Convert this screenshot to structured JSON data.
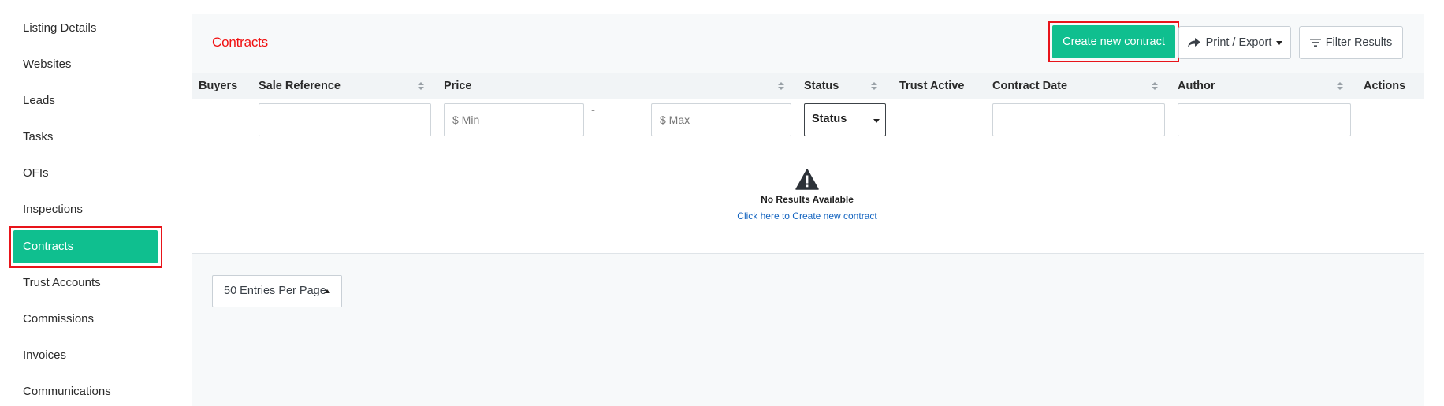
{
  "sidebar": {
    "items": [
      {
        "label": "Listing Details"
      },
      {
        "label": "Websites"
      },
      {
        "label": "Leads"
      },
      {
        "label": "Tasks"
      },
      {
        "label": "OFIs"
      },
      {
        "label": "Inspections"
      },
      {
        "label": "Contracts",
        "active": true
      },
      {
        "label": "Trust Accounts"
      },
      {
        "label": "Commissions"
      },
      {
        "label": "Invoices"
      },
      {
        "label": "Communications"
      }
    ]
  },
  "header": {
    "title": "Contracts",
    "create_label": "Create new contract",
    "print_label": "Print / Export",
    "filter_label": "Filter Results"
  },
  "table": {
    "columns": [
      "Buyers",
      "Sale Reference",
      "Price",
      "Status",
      "Trust Active",
      "Contract Date",
      "Author",
      "Actions"
    ],
    "filters": {
      "price_min_placeholder": "$ Min",
      "price_separator": "-",
      "price_max_placeholder": "$ Max",
      "status_selected": "Status"
    },
    "empty": {
      "message": "No Results Available",
      "link": "Click here to Create new contract"
    }
  },
  "pagination": {
    "per_page_label": "50 Entries Per Page"
  },
  "colors": {
    "accent": "#0fbf8f",
    "title": "#f01010",
    "highlight": "#e8141a",
    "link": "#1565c0"
  },
  "icons": [
    "share-arrow-icon",
    "filter-lines-icon",
    "warning-triangle-icon",
    "caret-down-icon",
    "caret-up-icon",
    "sort-icon"
  ]
}
